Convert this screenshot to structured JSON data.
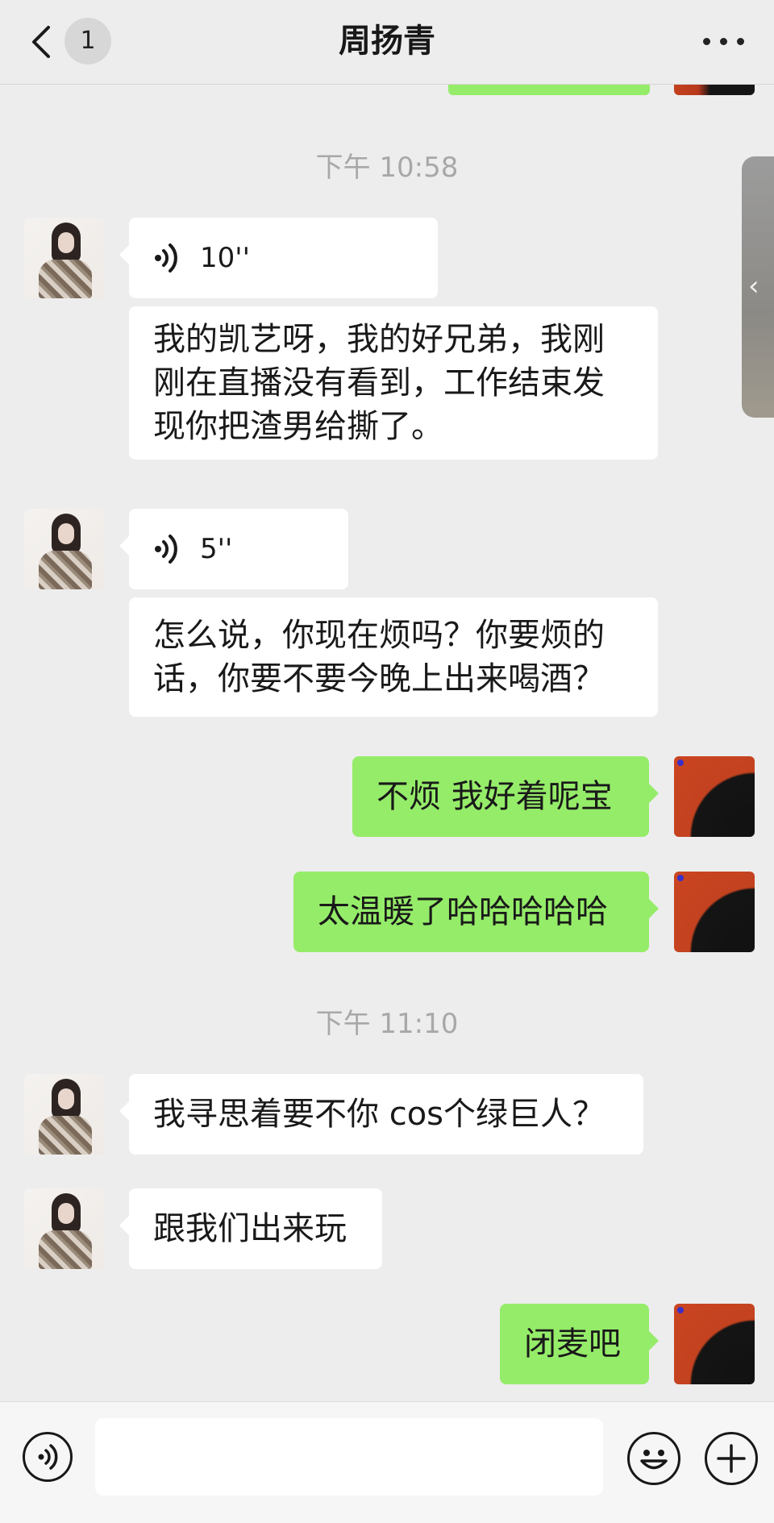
{
  "header": {
    "back_count": "1",
    "title": "周扬青"
  },
  "side_tab": {
    "arrow": "‹"
  },
  "messages": {
    "time1": "下午 10:58",
    "voice1": "10''",
    "text1": "我的凯艺呀，我的好兄弟，我刚刚在直播没有看到，工作结束发现你把渣男给撕了。",
    "voice2": "5''",
    "text2": "怎么说，你现在烦吗？你要烦的话，你要不要今晚上出来喝酒？",
    "out1": "不烦 我好着呢宝",
    "out2": "太温暖了哈哈哈哈哈",
    "time2": "下午 11:10",
    "text3": "我寻思着要不你 cos个绿巨人？",
    "text4": "跟我们出来玩",
    "out3": "闭麦吧"
  },
  "colors": {
    "background": "#ededed",
    "outgoing_bubble": "#95ec69",
    "incoming_bubble": "#ffffff"
  },
  "icons": [
    "back-chevron-icon",
    "more-dots-icon",
    "voice-wave-icon",
    "voice-input-icon",
    "emoji-icon",
    "plus-icon"
  ]
}
